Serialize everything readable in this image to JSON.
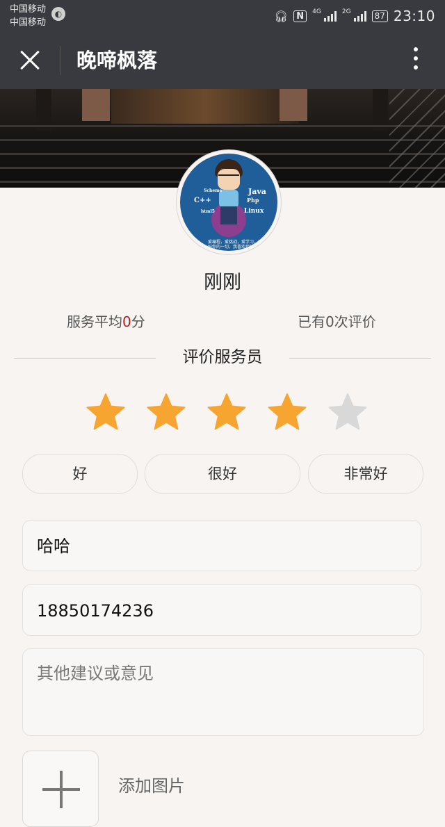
{
  "status_bar": {
    "carrier_1": "中国移动",
    "carrier_2": "中国移动",
    "network_1": "4G",
    "network_2": "2G",
    "battery": "87",
    "time": "23:10",
    "icons": [
      "headphones-icon",
      "nfc-icon",
      "signal-icon",
      "battery-icon"
    ]
  },
  "header": {
    "title": "晚啼枫落",
    "close_icon": "close-icon",
    "more_icon": "more-vertical-icon"
  },
  "profile": {
    "avatar_labels": [
      "Java",
      "C++",
      "Php",
      "Linux",
      "Scheme",
      "html5"
    ],
    "avatar_slogan": "爱编程，爱挑战，爱学习，爱好你的一切，我喜欢代码",
    "name": "刚刚",
    "avg_prefix": "服务平均",
    "avg_score": "0",
    "avg_suffix": "分",
    "review_count_text": "已有0次评价"
  },
  "rating": {
    "section_title": "评价服务员",
    "stars_selected": 4,
    "stars_total": 5,
    "star_active_color": "#f7a531",
    "star_inactive_color": "#d8d8d8"
  },
  "tags": [
    "好",
    "很好",
    "非常好"
  ],
  "form": {
    "name_value": "哈哈",
    "phone_value": "18850174236",
    "comment_placeholder": "其他建议或意见",
    "add_image_label": "添加图片"
  }
}
